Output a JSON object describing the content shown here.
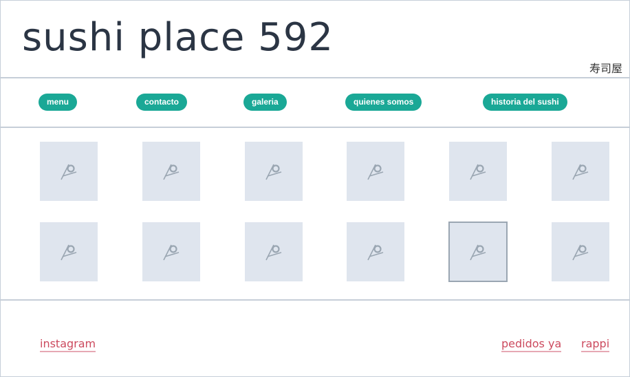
{
  "header": {
    "title": "sushi place 592",
    "kanji": "寿司屋"
  },
  "nav": {
    "items": [
      {
        "label": "menu"
      },
      {
        "label": "contacto"
      },
      {
        "label": "galeria"
      },
      {
        "label": "quienes somos"
      },
      {
        "label": "historia del sushi"
      }
    ]
  },
  "gallery": {
    "icon": "broken-image-icon",
    "rows": 2,
    "columns": 6,
    "selected_index": 10
  },
  "footer": {
    "links": {
      "instagram": "instagram",
      "pedidos_ya": "pedidos ya",
      "rappi": "rappi"
    }
  },
  "colors": {
    "accent": "#1aa896",
    "link": "#cc4a5e",
    "placeholder_bg": "#dfe5ee",
    "border": "#c6ced8",
    "title": "#2b3544"
  }
}
